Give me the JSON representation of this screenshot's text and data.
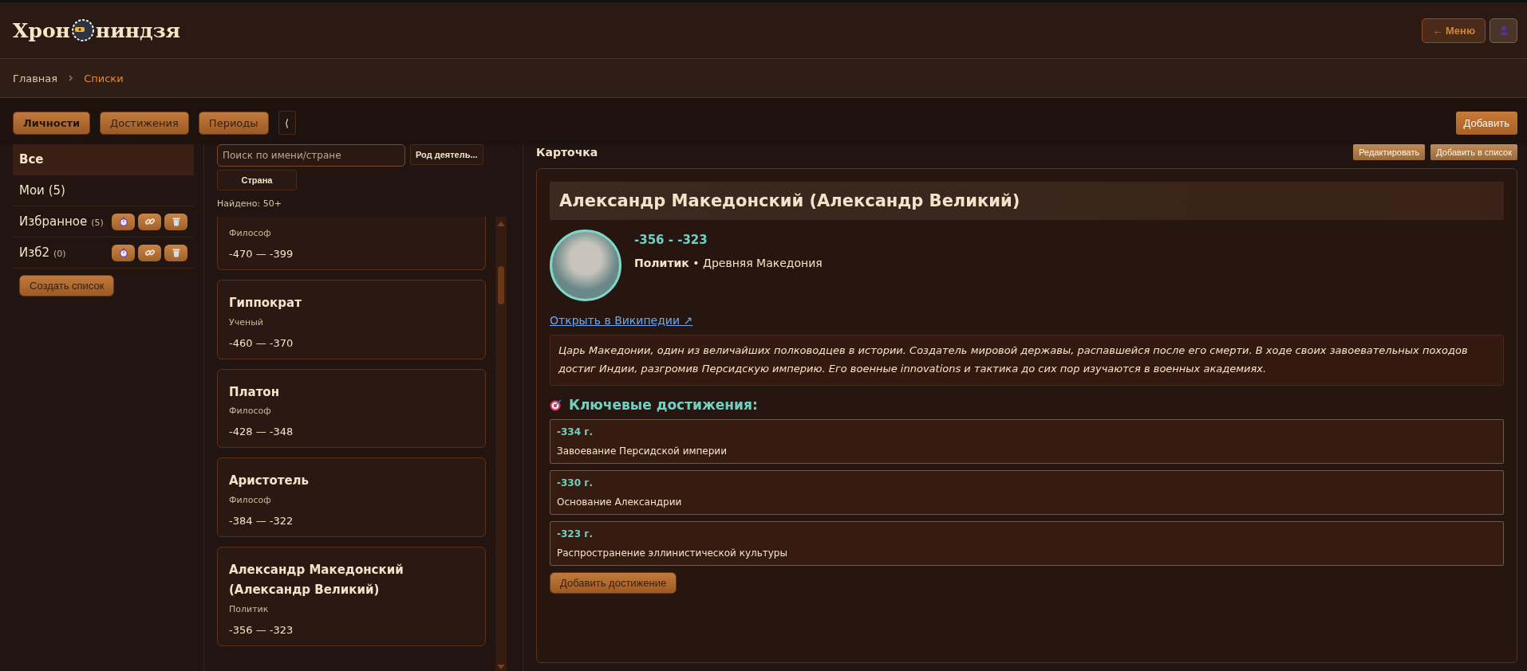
{
  "header": {
    "logo_left": "Хрон",
    "logo_right": "ниндзя",
    "menu_button": "← Меню"
  },
  "breadcrumb": [
    {
      "label": "Главная",
      "selected": false
    },
    {
      "label": "Списки",
      "selected": true
    }
  ],
  "tabs": [
    {
      "label": "Личности",
      "selected": true
    },
    {
      "label": "Достижения",
      "selected": false
    },
    {
      "label": "Периоды",
      "selected": false
    }
  ],
  "collapse_button": "⟨",
  "add_button": "Добавить",
  "lists": [
    {
      "label": "Все",
      "selected": true,
      "actions": false
    },
    {
      "label": "Мои (5)",
      "selected": false,
      "actions": false
    },
    {
      "label": "Избранное",
      "count": "(5)",
      "selected": false,
      "actions": true
    },
    {
      "label": "Изб2",
      "count": "(0)",
      "selected": false,
      "actions": true
    }
  ],
  "create_list_button": "Создать список",
  "search": {
    "placeholder": "Поиск по имени/стране"
  },
  "filters": [
    "Род деятель...",
    "Страна"
  ],
  "found": "Найдено: 50+",
  "people": [
    {
      "role": "Философ",
      "years": "-470 — -399"
    },
    {
      "name": "Гиппократ",
      "role": "Ученый",
      "years": "-460 — -370"
    },
    {
      "name": "Платон",
      "role": "Философ",
      "years": "-428 — -348"
    },
    {
      "name": "Аристотель",
      "role": "Философ",
      "years": "-384 — -322"
    },
    {
      "name": "Александр Македонский (Александр Великий)",
      "role": "Политик",
      "years": "-356 — -323"
    }
  ],
  "card": {
    "heading": "Карточка",
    "buttons": [
      "Редактировать",
      "Добавить в список"
    ],
    "name": "Александр Македонский (Александр Великий)",
    "years": "-356 - -323",
    "role_line": "**Политик** • Древняя Македония",
    "wiki_link": "Открыть в Википедии ↗",
    "description": "Царь Македонии, один из величайших полководцев в истории. Создатель мировой державы, распавшейся после его смерти. В ходе своих завоевательных походов достиг Индии, разгромив Персидскую империю. Его военные innovations и тактика до сих пор изучаются в военных академиях.",
    "achievements_title": "Ключевые достижения:",
    "achievements": [
      {
        "year": "-334 г.",
        "text": "Завоевание Персидской империи"
      },
      {
        "year": "-330 г.",
        "text": "Основание Александрии"
      },
      {
        "year": "-323 г.",
        "text": "Распространение эллинистической культуры"
      }
    ],
    "add_achievement_button": "Добавить достижение"
  }
}
